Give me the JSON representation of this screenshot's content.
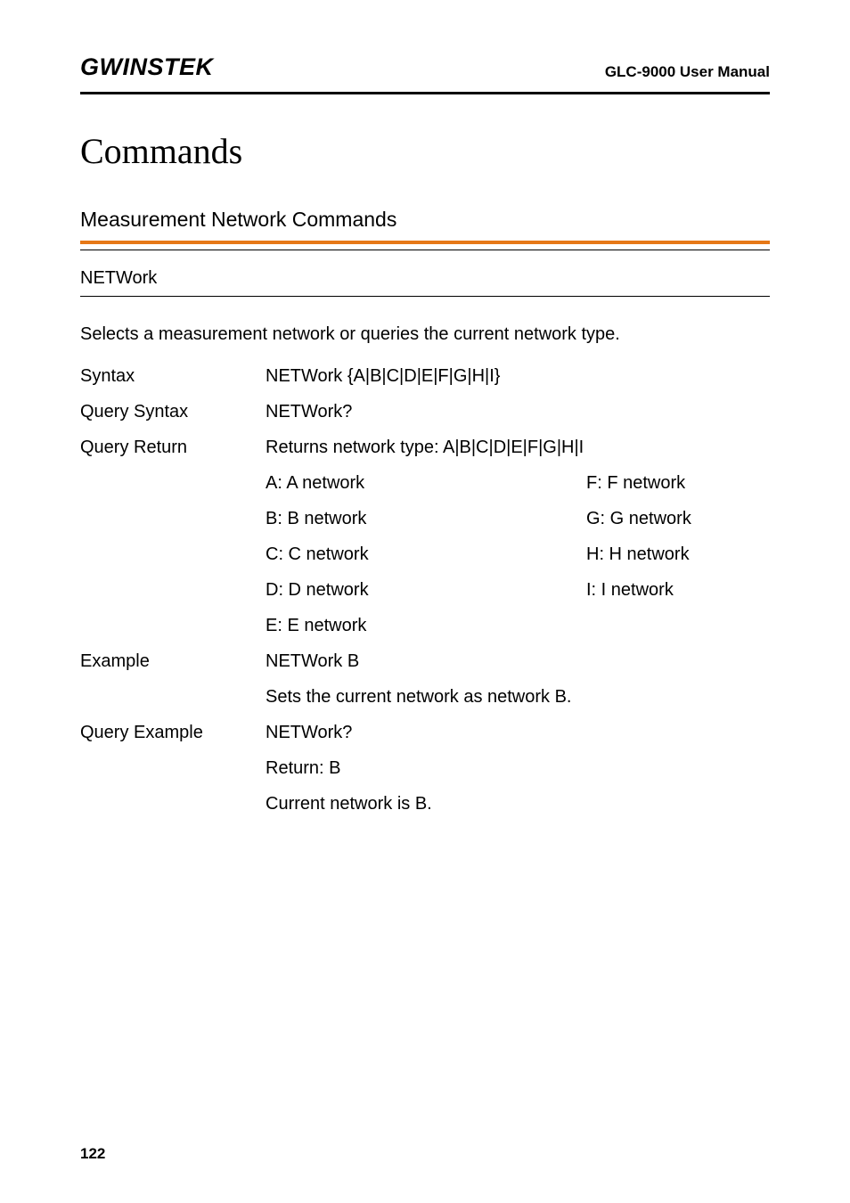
{
  "header": {
    "logo": "GWINSTEK",
    "manual_title": "GLC-9000 User Manual"
  },
  "heading1": "Commands",
  "heading2": "Measurement Network Commands",
  "heading3": "NETWork",
  "desc": "Selects a measurement network or queries the current network type.",
  "rows": {
    "syntax_label": "Syntax",
    "syntax_value": "NETWork {A|B|C|D|E|F|G|H|I}",
    "query_syntax_label": "Query Syntax",
    "query_syntax_value": "NETWork?",
    "query_return_label": "Query Return",
    "query_return_value": "Returns network type: A|B|C|D|E|F|G|H|I",
    "net_a": "A: A network",
    "net_b": "B: B network",
    "net_c": "C: C network",
    "net_d": "D: D network",
    "net_e": "E: E network",
    "net_f": "F: F network",
    "net_g": "G: G network",
    "net_h": "H: H network",
    "net_i": "I: I network",
    "example_label": "Example",
    "example_value1": "NETWork B",
    "example_value2": "Sets the current network as network B.",
    "query_example_label": "Query Example",
    "query_example_value1": "NETWork?",
    "query_example_value2": "Return: B",
    "query_example_value3": "Current network is B."
  },
  "page_num": "122"
}
